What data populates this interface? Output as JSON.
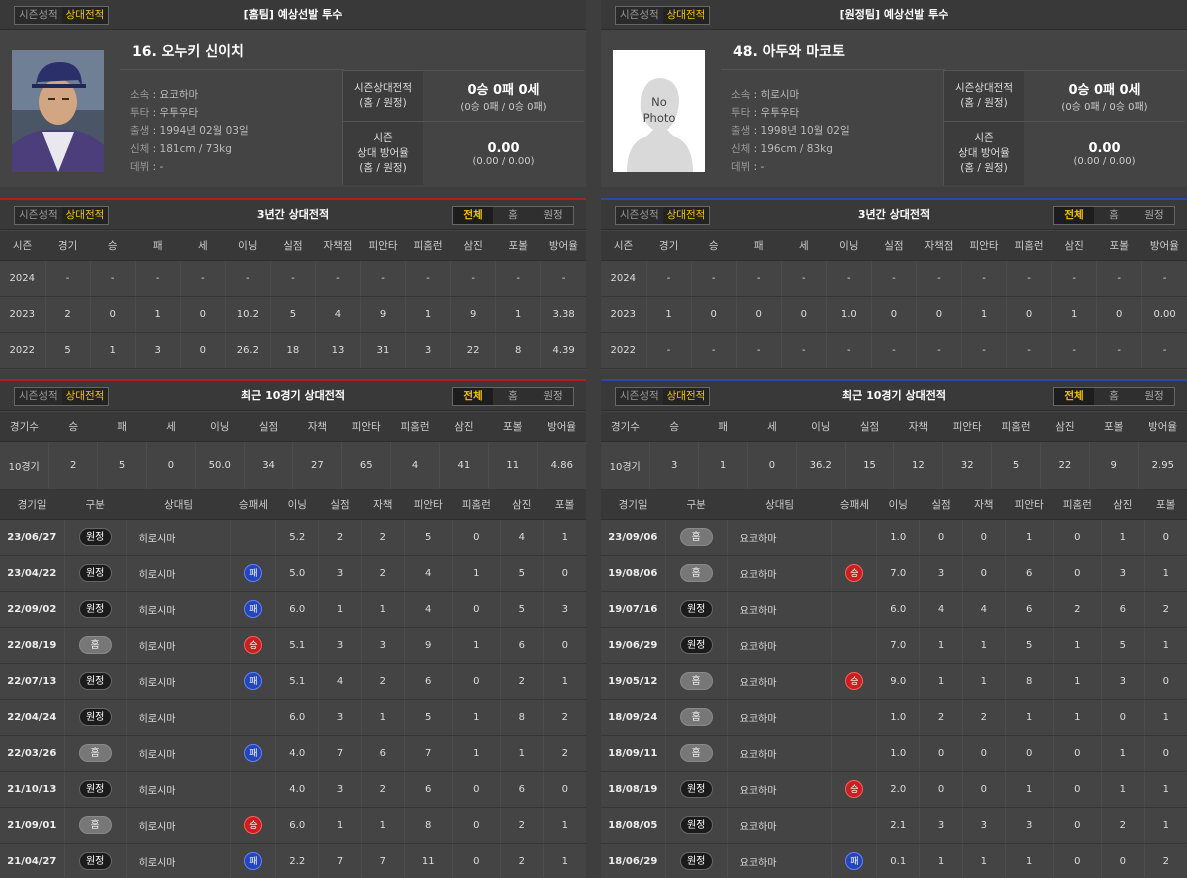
{
  "toggle": {
    "season_label": "시즌성적",
    "vs_label": "상대전적"
  },
  "segments": {
    "all": "전체",
    "home": "홈",
    "away": "원정"
  },
  "colors": {
    "accent_highlight": "#f5c400",
    "home_accent": "#b01e1e",
    "away_accent": "#2a4aa8",
    "win": "#c62020",
    "loss": "#2446b8"
  },
  "left": {
    "header_title": "[홈팀] 예상선발 투수",
    "player": {
      "name": "16. 오누키 신이치",
      "info": [
        {
          "label": "소속",
          "value": "요코하마"
        },
        {
          "label": "투타",
          "value": "우투우타"
        },
        {
          "label": "출생",
          "value": "1994년 02월 03일"
        },
        {
          "label": "신체",
          "value": "181cm / 73kg"
        },
        {
          "label": "데뷔",
          "value": "-"
        }
      ],
      "record_label_1": "시즌상대전적",
      "record_label_2": "(홈 / 원정)",
      "record_value": "0승 0패 0세",
      "record_sub": "(0승 0패 / 0승 0패)",
      "era_label_1": "시즌",
      "era_label_2": "상대 방어율",
      "era_label_3": "(홈 / 원정)",
      "era_value": "0.00",
      "era_sub": "(0.00 / 0.00)"
    },
    "three_year": {
      "title": "3년간 상대전적",
      "headers": [
        "시즌",
        "경기",
        "승",
        "패",
        "세",
        "이닝",
        "실점",
        "자책점",
        "피안타",
        "피홈런",
        "삼진",
        "포볼",
        "방어율"
      ],
      "rows": [
        [
          "2024",
          "-",
          "-",
          "-",
          "-",
          "-",
          "-",
          "-",
          "-",
          "-",
          "-",
          "-",
          "-"
        ],
        [
          "2023",
          "2",
          "0",
          "1",
          "0",
          "10.2",
          "5",
          "4",
          "9",
          "1",
          "9",
          "1",
          "3.38"
        ],
        [
          "2022",
          "5",
          "1",
          "3",
          "0",
          "26.2",
          "18",
          "13",
          "31",
          "3",
          "22",
          "8",
          "4.39"
        ]
      ]
    },
    "recent": {
      "title": "최근 10경기 상대전적",
      "summary_headers": [
        "경기수",
        "승",
        "패",
        "세",
        "이닝",
        "실점",
        "자책",
        "피안타",
        "피홈런",
        "삼진",
        "포볼",
        "방어율"
      ],
      "summary_row": [
        "10경기",
        "2",
        "5",
        "0",
        "50.0",
        "34",
        "27",
        "65",
        "4",
        "41",
        "11",
        "4.86"
      ],
      "game_headers": [
        "경기일",
        "구분",
        "상대팀",
        "승패세",
        "이닝",
        "실점",
        "자책",
        "피안타",
        "피홈런",
        "삼진",
        "포볼"
      ],
      "games": [
        {
          "date": "23/06/27",
          "loc": "원정",
          "opp": "히로시마",
          "res": "",
          "stats": [
            "5.2",
            "2",
            "2",
            "5",
            "0",
            "4",
            "1"
          ]
        },
        {
          "date": "23/04/22",
          "loc": "원정",
          "opp": "히로시마",
          "res": "패",
          "stats": [
            "5.0",
            "3",
            "2",
            "4",
            "1",
            "5",
            "0"
          ]
        },
        {
          "date": "22/09/02",
          "loc": "원정",
          "opp": "히로시마",
          "res": "패",
          "stats": [
            "6.0",
            "1",
            "1",
            "4",
            "0",
            "5",
            "3"
          ]
        },
        {
          "date": "22/08/19",
          "loc": "홈",
          "opp": "히로시마",
          "res": "승",
          "stats": [
            "5.1",
            "3",
            "3",
            "9",
            "1",
            "6",
            "0"
          ]
        },
        {
          "date": "22/07/13",
          "loc": "원정",
          "opp": "히로시마",
          "res": "패",
          "stats": [
            "5.1",
            "4",
            "2",
            "6",
            "0",
            "2",
            "1"
          ]
        },
        {
          "date": "22/04/24",
          "loc": "원정",
          "opp": "히로시마",
          "res": "",
          "stats": [
            "6.0",
            "3",
            "1",
            "5",
            "1",
            "8",
            "2"
          ]
        },
        {
          "date": "22/03/26",
          "loc": "홈",
          "opp": "히로시마",
          "res": "패",
          "stats": [
            "4.0",
            "7",
            "6",
            "7",
            "1",
            "1",
            "2"
          ]
        },
        {
          "date": "21/10/13",
          "loc": "원정",
          "opp": "히로시마",
          "res": "",
          "stats": [
            "4.0",
            "3",
            "2",
            "6",
            "0",
            "6",
            "0"
          ]
        },
        {
          "date": "21/09/01",
          "loc": "홈",
          "opp": "히로시마",
          "res": "승",
          "stats": [
            "6.0",
            "1",
            "1",
            "8",
            "0",
            "2",
            "1"
          ]
        },
        {
          "date": "21/04/27",
          "loc": "원정",
          "opp": "히로시마",
          "res": "패",
          "stats": [
            "2.2",
            "7",
            "7",
            "11",
            "0",
            "2",
            "1"
          ]
        }
      ]
    }
  },
  "right": {
    "header_title": "[원정팀] 예상선발 투수",
    "player": {
      "name": "48. 아두와 마코토",
      "photo_placeholder": "No Photo",
      "info": [
        {
          "label": "소속",
          "value": "히로시마"
        },
        {
          "label": "투타",
          "value": "우투우타"
        },
        {
          "label": "출생",
          "value": "1998년 10월 02일"
        },
        {
          "label": "신체",
          "value": "196cm / 83kg"
        },
        {
          "label": "데뷔",
          "value": "-"
        }
      ],
      "record_label_1": "시즌상대전적",
      "record_label_2": "(홈 / 원정)",
      "record_value": "0승 0패 0세",
      "record_sub": "(0승 0패 / 0승 0패)",
      "era_label_1": "시즌",
      "era_label_2": "상대 방어율",
      "era_label_3": "(홈 / 원정)",
      "era_value": "0.00",
      "era_sub": "(0.00 / 0.00)"
    },
    "three_year": {
      "title": "3년간 상대전적",
      "headers": [
        "시즌",
        "경기",
        "승",
        "패",
        "세",
        "이닝",
        "실점",
        "자책점",
        "피안타",
        "피홈런",
        "삼진",
        "포볼",
        "방어율"
      ],
      "rows": [
        [
          "2024",
          "-",
          "-",
          "-",
          "-",
          "-",
          "-",
          "-",
          "-",
          "-",
          "-",
          "-",
          "-"
        ],
        [
          "2023",
          "1",
          "0",
          "0",
          "0",
          "1.0",
          "0",
          "0",
          "1",
          "0",
          "1",
          "0",
          "0.00"
        ],
        [
          "2022",
          "-",
          "-",
          "-",
          "-",
          "-",
          "-",
          "-",
          "-",
          "-",
          "-",
          "-",
          "-"
        ]
      ]
    },
    "recent": {
      "title": "최근 10경기 상대전적",
      "summary_headers": [
        "경기수",
        "승",
        "패",
        "세",
        "이닝",
        "실점",
        "자책",
        "피안타",
        "피홈런",
        "삼진",
        "포볼",
        "방어율"
      ],
      "summary_row": [
        "10경기",
        "3",
        "1",
        "0",
        "36.2",
        "15",
        "12",
        "32",
        "5",
        "22",
        "9",
        "2.95"
      ],
      "game_headers": [
        "경기일",
        "구분",
        "상대팀",
        "승패세",
        "이닝",
        "실점",
        "자책",
        "피안타",
        "피홈런",
        "삼진",
        "포볼"
      ],
      "games": [
        {
          "date": "23/09/06",
          "loc": "홈",
          "opp": "요코하마",
          "res": "",
          "stats": [
            "1.0",
            "0",
            "0",
            "1",
            "0",
            "1",
            "0"
          ]
        },
        {
          "date": "19/08/06",
          "loc": "홈",
          "opp": "요코하마",
          "res": "승",
          "stats": [
            "7.0",
            "3",
            "0",
            "6",
            "0",
            "3",
            "1"
          ]
        },
        {
          "date": "19/07/16",
          "loc": "원정",
          "opp": "요코하마",
          "res": "",
          "stats": [
            "6.0",
            "4",
            "4",
            "6",
            "2",
            "6",
            "2"
          ]
        },
        {
          "date": "19/06/29",
          "loc": "원정",
          "opp": "요코하마",
          "res": "",
          "stats": [
            "7.0",
            "1",
            "1",
            "5",
            "1",
            "5",
            "1"
          ]
        },
        {
          "date": "19/05/12",
          "loc": "홈",
          "opp": "요코하마",
          "res": "승",
          "stats": [
            "9.0",
            "1",
            "1",
            "8",
            "1",
            "3",
            "0"
          ]
        },
        {
          "date": "18/09/24",
          "loc": "홈",
          "opp": "요코하마",
          "res": "",
          "stats": [
            "1.0",
            "2",
            "2",
            "1",
            "1",
            "0",
            "1"
          ]
        },
        {
          "date": "18/09/11",
          "loc": "홈",
          "opp": "요코하마",
          "res": "",
          "stats": [
            "1.0",
            "0",
            "0",
            "0",
            "0",
            "1",
            "0"
          ]
        },
        {
          "date": "18/08/19",
          "loc": "원정",
          "opp": "요코하마",
          "res": "승",
          "stats": [
            "2.0",
            "0",
            "0",
            "1",
            "0",
            "1",
            "1"
          ]
        },
        {
          "date": "18/08/05",
          "loc": "원정",
          "opp": "요코하마",
          "res": "",
          "stats": [
            "2.1",
            "3",
            "3",
            "3",
            "0",
            "2",
            "1"
          ]
        },
        {
          "date": "18/06/29",
          "loc": "원정",
          "opp": "요코하마",
          "res": "패",
          "stats": [
            "0.1",
            "1",
            "1",
            "1",
            "0",
            "0",
            "2"
          ]
        }
      ]
    }
  }
}
